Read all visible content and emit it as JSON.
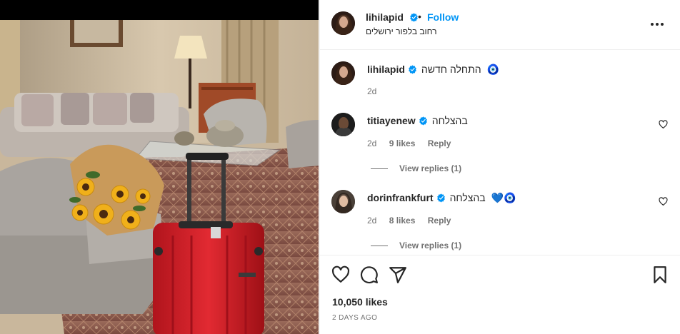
{
  "post": {
    "author": "lihilapid",
    "follow_label": "Follow",
    "separator": "•",
    "location": "רחוב בלפור ירושלים",
    "caption": {
      "username": "lihilapid",
      "text": "התחלה חדשה",
      "emoji": "🧿",
      "time": "2d"
    },
    "likes": "10,050 likes",
    "time_ago": "2 DAYS AGO"
  },
  "comments": [
    {
      "username": "titiayenew",
      "text": "בהצלחה",
      "time": "2d",
      "likes": "9 likes",
      "reply_label": "Reply",
      "view_replies": "View replies (1)"
    },
    {
      "username": "dorinfrankfurt",
      "text": "בהצלחה",
      "emoji": "💙🧿",
      "time": "2d",
      "likes": "8 likes",
      "reply_label": "Reply",
      "view_replies": "View replies (1)"
    }
  ],
  "icons": {
    "verified": "verified-badge-icon",
    "more": "more-options-icon",
    "like": "heart-icon",
    "comment": "comment-bubble-icon",
    "share": "paper-plane-icon",
    "save": "bookmark-icon"
  },
  "colors": {
    "accent": "#0095f6",
    "verified": "#0095f6",
    "secondary_text": "#737373",
    "suitcase": "#d8202a"
  }
}
